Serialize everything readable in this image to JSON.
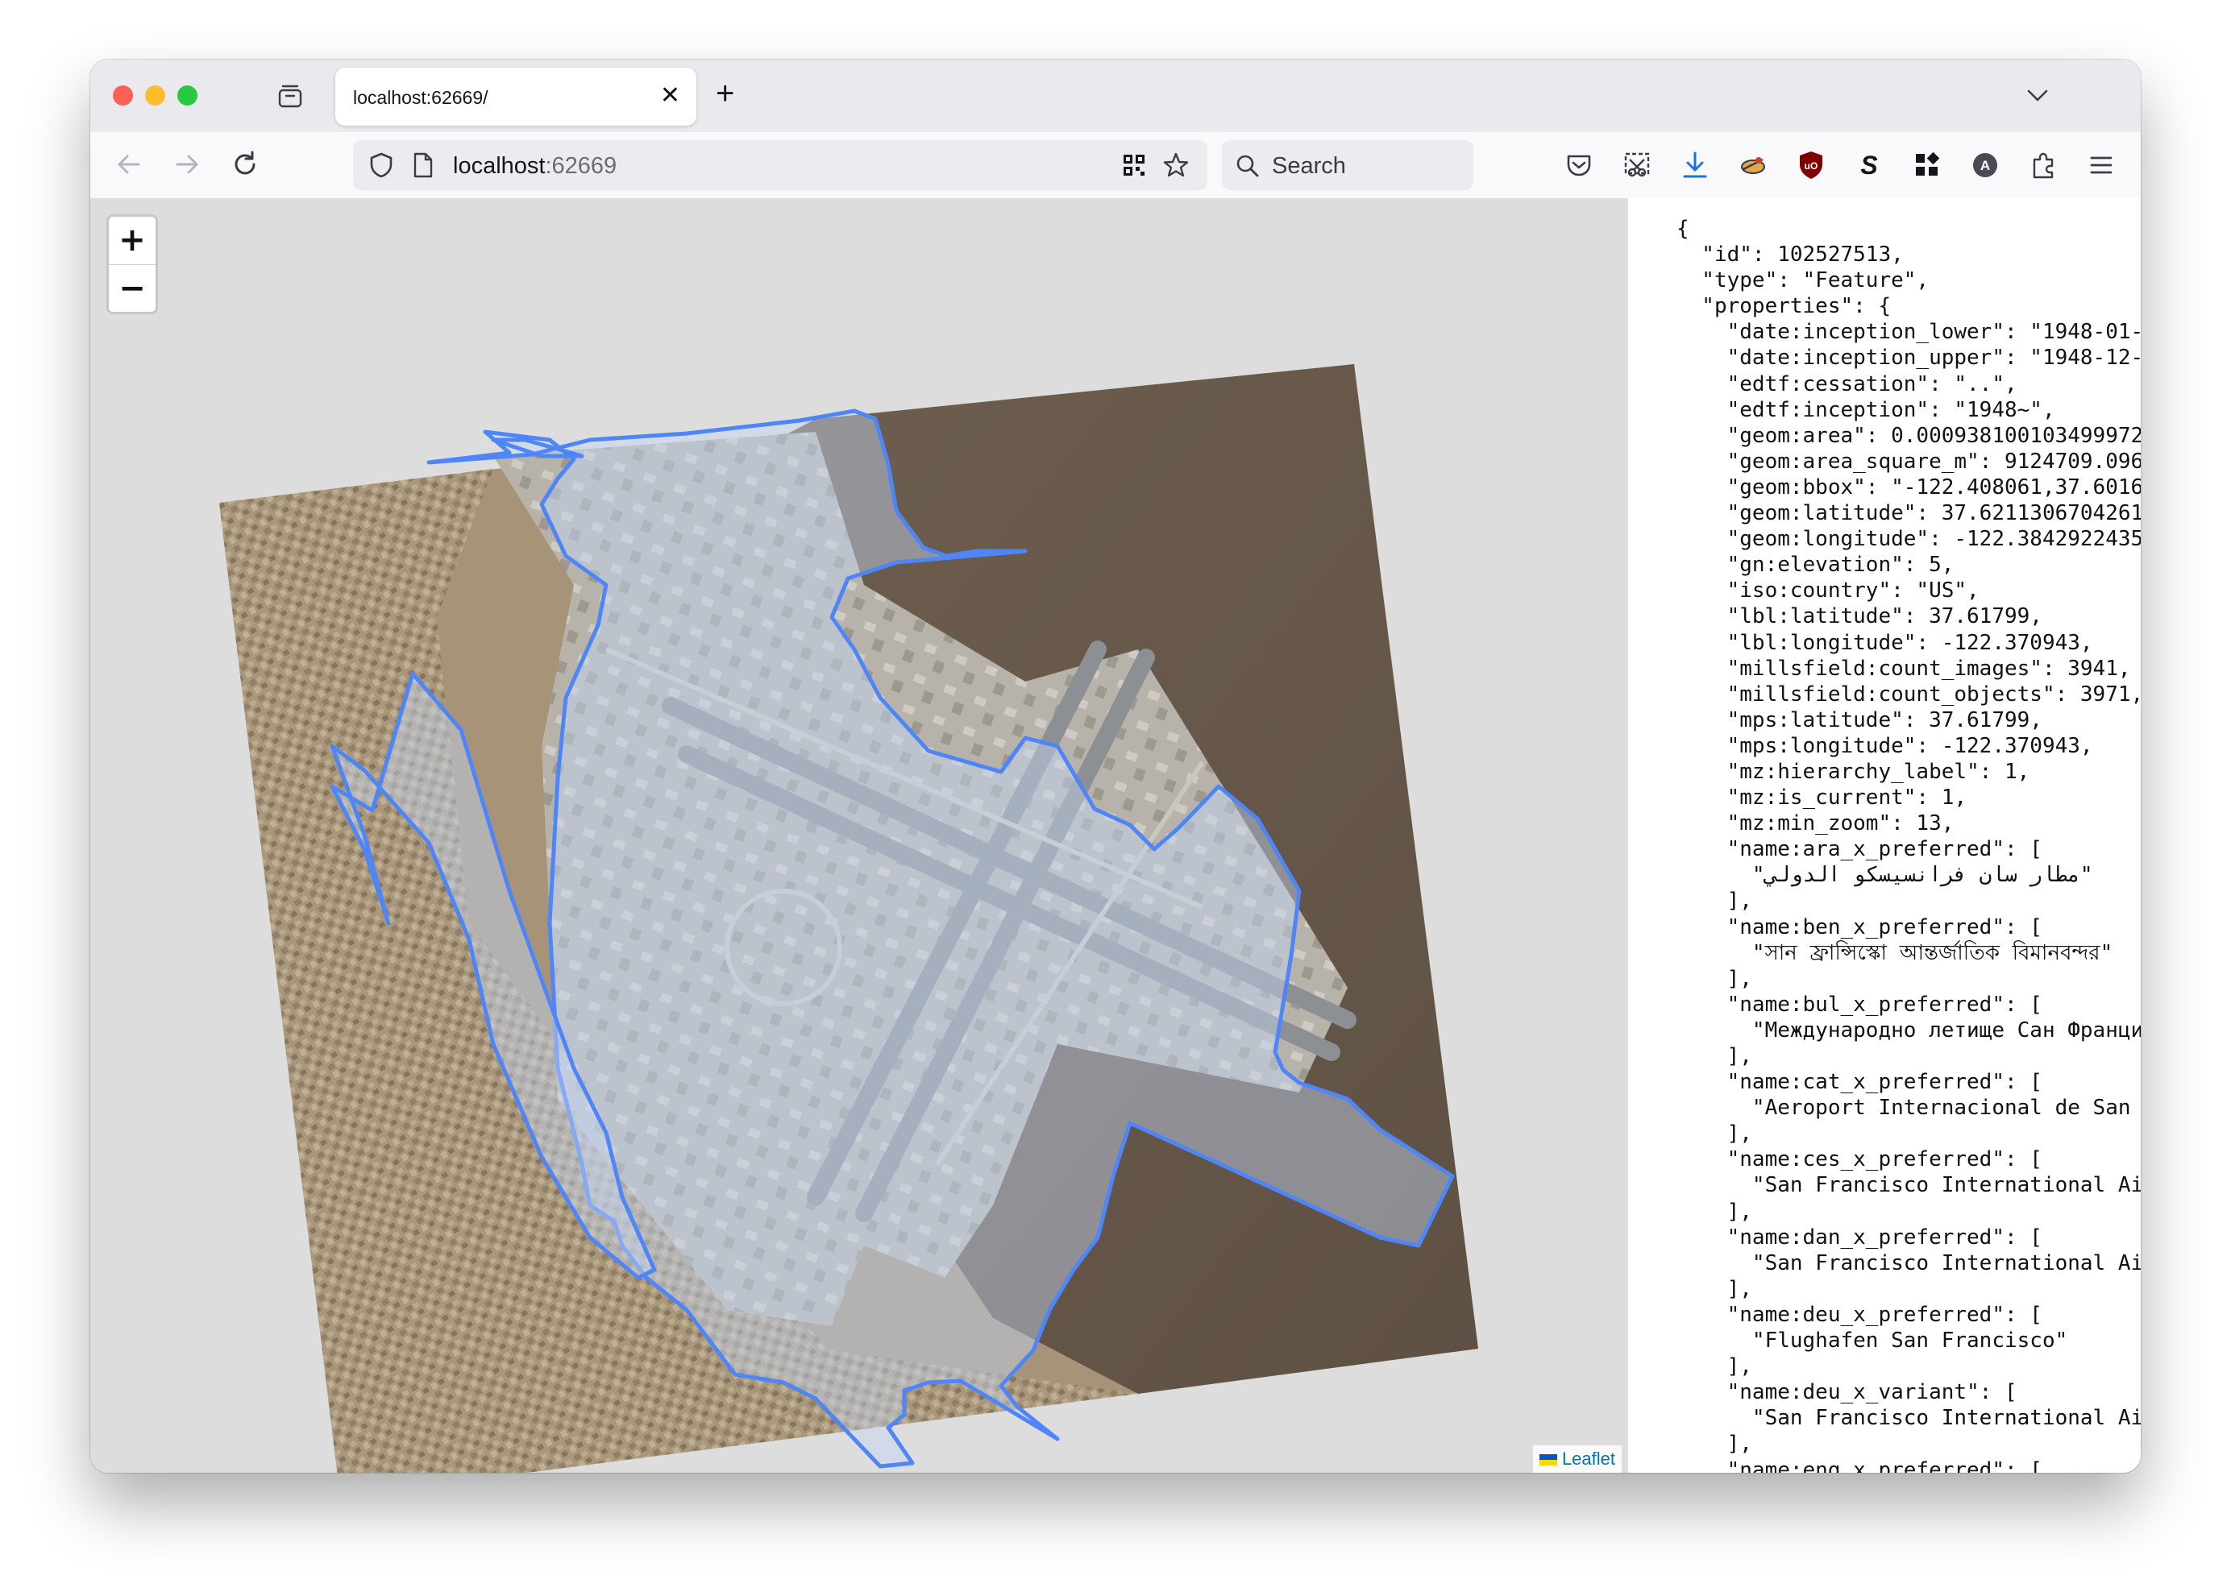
{
  "window": {
    "tab_title": "localhost:62669/",
    "url_host": "localhost",
    "url_port": ":62669",
    "search_placeholder": "Search"
  },
  "map": {
    "zoom_in": "+",
    "zoom_out": "−",
    "attribution": "Leaflet",
    "colors": {
      "polygon_stroke": "#4f86f7",
      "polygon_fill": "#b8cdf2",
      "water": "#6d5e4f",
      "land": "#a59377"
    }
  },
  "json_lines": [
    "{",
    "  \"id\": 102527513,",
    "  \"type\": \"Feature\",",
    "  \"properties\": {",
    "    \"date:inception_lower\": \"1948-01-",
    "    \"date:inception_upper\": \"1948-12-",
    "    \"edtf:cessation\": \"..\",",
    "    \"edtf:inception\": \"1948~\",",
    "    \"geom:area\": 0.000938100103499972",
    "    \"geom:area_square_m\": 9124709.096",
    "    \"geom:bbox\": \"-122.408061,37.6016",
    "    \"geom:latitude\": 37.6211306704261",
    "    \"geom:longitude\": -122.3842922435",
    "    \"gn:elevation\": 5,",
    "    \"iso:country\": \"US\",",
    "    \"lbl:latitude\": 37.61799,",
    "    \"lbl:longitude\": -122.370943,",
    "    \"millsfield:count_images\": 3941,",
    "    \"millsfield:count_objects\": 3971,",
    "    \"mps:latitude\": 37.61799,",
    "    \"mps:longitude\": -122.370943,",
    "    \"mz:hierarchy_label\": 1,",
    "    \"mz:is_current\": 1,",
    "    \"mz:min_zoom\": 13,",
    "    \"name:ara_x_preferred\": [",
    "      \"مطار سان فرانسيسكو الدولي\"",
    "    ],",
    "    \"name:ben_x_preferred\": [",
    "      \"সান ফ্রান্সিস্কো আন্তর্জাতিক বিমানবন্দর\"",
    "    ],",
    "    \"name:bul_x_preferred\": [",
    "      \"Международно летище Сан Франци",
    "    ],",
    "    \"name:cat_x_preferred\": [",
    "      \"Aeroport Internacional de San ",
    "    ],",
    "    \"name:ces_x_preferred\": [",
    "      \"San Francisco International Ai",
    "    ],",
    "    \"name:dan_x_preferred\": [",
    "      \"San Francisco International Ai",
    "    ],",
    "    \"name:deu_x_preferred\": [",
    "      \"Flughafen San Francisco\"",
    "    ],",
    "    \"name:deu_x_variant\": [",
    "      \"San Francisco International Ai",
    "    ],",
    "    \"name:eng_x_preferred\": ["
  ]
}
